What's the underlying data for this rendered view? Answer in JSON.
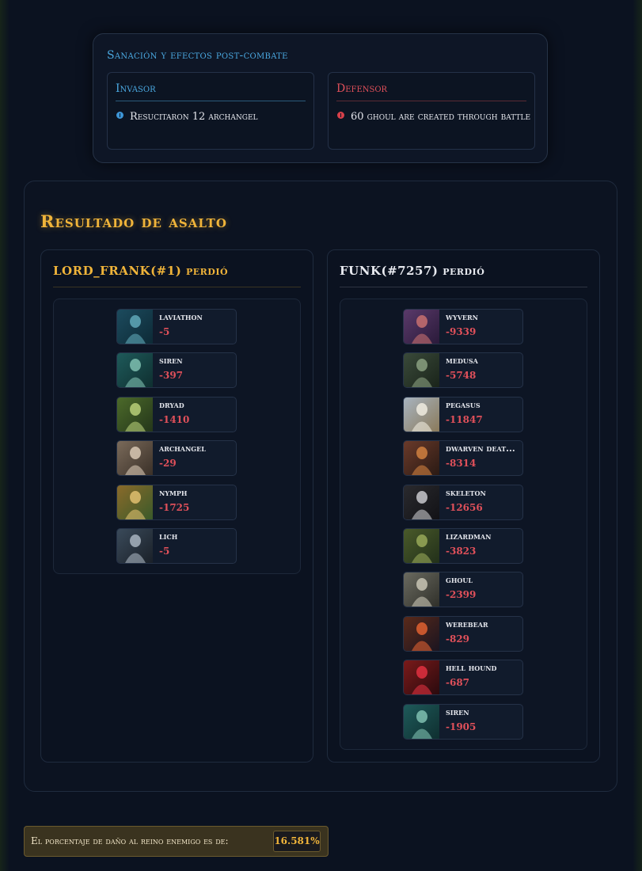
{
  "colors": {
    "gold": "#f0b43a",
    "invader_blue": "#4aa8e0",
    "defender_red": "#e0505a",
    "panel_bg": "#0c1321"
  },
  "healing": {
    "title": "Sanación y efectos post-combate",
    "invader": {
      "heading": "Invasor",
      "icon": "info-icon",
      "entry": "Resucitaron 12 archangel"
    },
    "defender": {
      "heading": "Defensor",
      "icon": "alert-icon",
      "entry": "60 ghoul are created through battle"
    }
  },
  "assault": {
    "title": "Resultado de asalto",
    "attacker": {
      "heading": "LORD_FRANK(#1) perdió",
      "units": [
        {
          "name": "laviathon",
          "loss": "-5"
        },
        {
          "name": "siren",
          "loss": "-397"
        },
        {
          "name": "dryad",
          "loss": "-1410"
        },
        {
          "name": "archangel",
          "loss": "-29"
        },
        {
          "name": "nymph",
          "loss": "-1725"
        },
        {
          "name": "lich",
          "loss": "-5"
        }
      ]
    },
    "defender": {
      "heading": "FUNK(#7257) perdió",
      "units": [
        {
          "name": "wyvern",
          "loss": "-9339"
        },
        {
          "name": "medusa",
          "loss": "-5748"
        },
        {
          "name": "pegasus",
          "loss": "-11847"
        },
        {
          "name": "dwarven deat...",
          "loss": "-8314"
        },
        {
          "name": "skeleton",
          "loss": "-12656"
        },
        {
          "name": "lizardman",
          "loss": "-3823"
        },
        {
          "name": "ghoul",
          "loss": "-2399"
        },
        {
          "name": "werebear",
          "loss": "-829"
        },
        {
          "name": "hell hound",
          "loss": "-687"
        },
        {
          "name": "siren",
          "loss": "-1905"
        }
      ]
    }
  },
  "damage": {
    "label": "El porcentaje de daño al reino enemigo es de:",
    "value": "16.581%"
  }
}
